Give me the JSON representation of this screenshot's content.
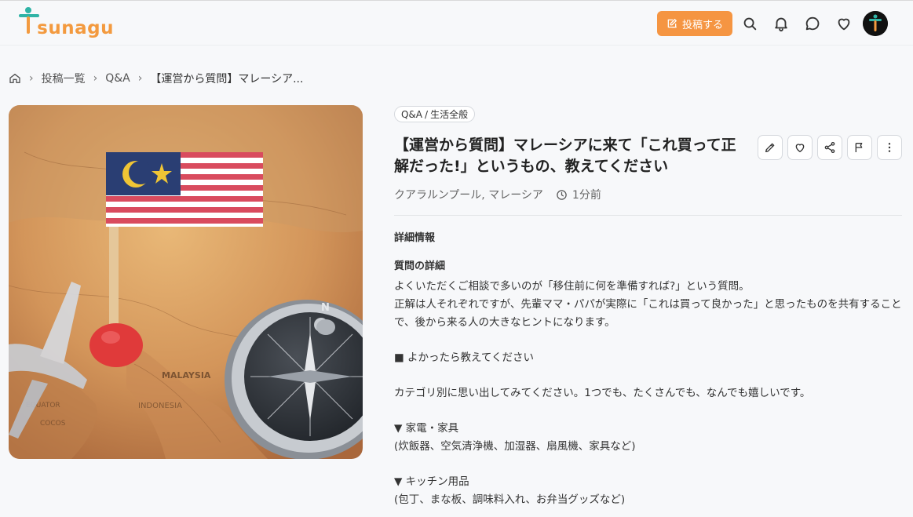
{
  "header": {
    "logo": {
      "first": "T",
      "rest": "sunagu"
    },
    "post_button": "投稿する",
    "icons": [
      "search-icon",
      "bell-icon",
      "chat-icon",
      "heart-icon"
    ]
  },
  "breadcrumb": {
    "items": [
      "投稿一覧",
      "Q&A"
    ],
    "current": "【運営から質問】マレーシア..."
  },
  "post": {
    "tag": {
      "category": "Q&A",
      "slash": "/",
      "sub": "生活全般"
    },
    "title": "【運営から質問】マレーシアに来て「これ買って正解だった!」というもの、教えてください",
    "location": "クアラルンプール, マレーシア",
    "time": "1分前",
    "details_heading": "詳細情報",
    "question_heading": "質問の詳細",
    "paragraphs": [
      "よくいただくご相談で多いのが「移住前に何を準備すれば?」という質問。\n正解は人それぞれですが、先輩ママ・パパが実際に「これは買って良かった」と思ったものを共有することで、後から来る人の大きなヒントになります。",
      "■ よかったら教えてください",
      "カテゴリ別に思い出してみてください。1つでも、たくさんでも、なんでも嬉しいです。",
      "▼ 家電・家具\n(炊飯器、空気清浄機、加湿器、扇風機、家具など)",
      "▼ キッチン用品\n(包丁、まな板、調味料入れ、お弁当グッズなど)"
    ]
  },
  "colors": {
    "accent": "#f59542",
    "teal": "#2fb3a6"
  }
}
